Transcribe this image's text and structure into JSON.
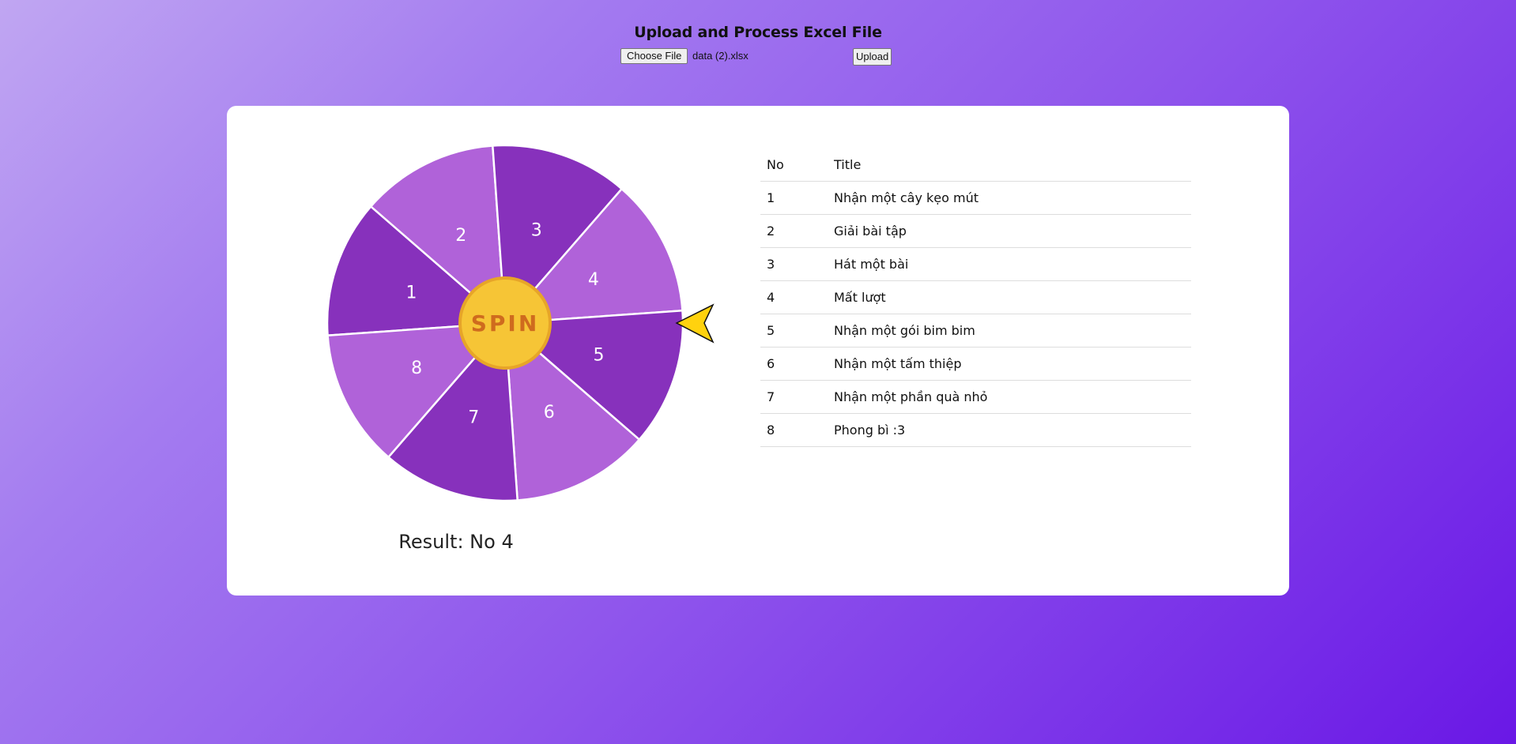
{
  "upload": {
    "title": "Upload and Process Excel File",
    "choose_file_label": "Choose File",
    "file_name": "data (2).xlsx",
    "upload_label": "Upload"
  },
  "wheel": {
    "segments": [
      "1",
      "2",
      "3",
      "4",
      "5",
      "6",
      "7",
      "8"
    ],
    "colors": {
      "dark": "#8731bc",
      "light": "#b062d9",
      "divider": "#ffffff"
    },
    "spin_label": "SPIN",
    "spin_colors": {
      "fill": "#f6c536",
      "edge": "#e7a528",
      "text": "#cf6b1e"
    },
    "pointer": {
      "fill": "#ffd20e",
      "stroke": "#111111",
      "icon": "arrow-pointer-icon"
    }
  },
  "result": {
    "label": "Result:",
    "value": "No 4"
  },
  "table": {
    "headers": {
      "no": "No",
      "title": "Title"
    },
    "rows": [
      {
        "no": "1",
        "title": "Nhận một cây kẹo mút"
      },
      {
        "no": "2",
        "title": "Giải bài tập"
      },
      {
        "no": "3",
        "title": "Hát một bài"
      },
      {
        "no": "4",
        "title": "Mất lượt"
      },
      {
        "no": "5",
        "title": "Nhận một gói bim bim"
      },
      {
        "no": "6",
        "title": "Nhận một tấm thiệp"
      },
      {
        "no": "7",
        "title": "Nhận một phần quà nhỏ"
      },
      {
        "no": "8",
        "title": "Phong bì :3"
      }
    ]
  }
}
